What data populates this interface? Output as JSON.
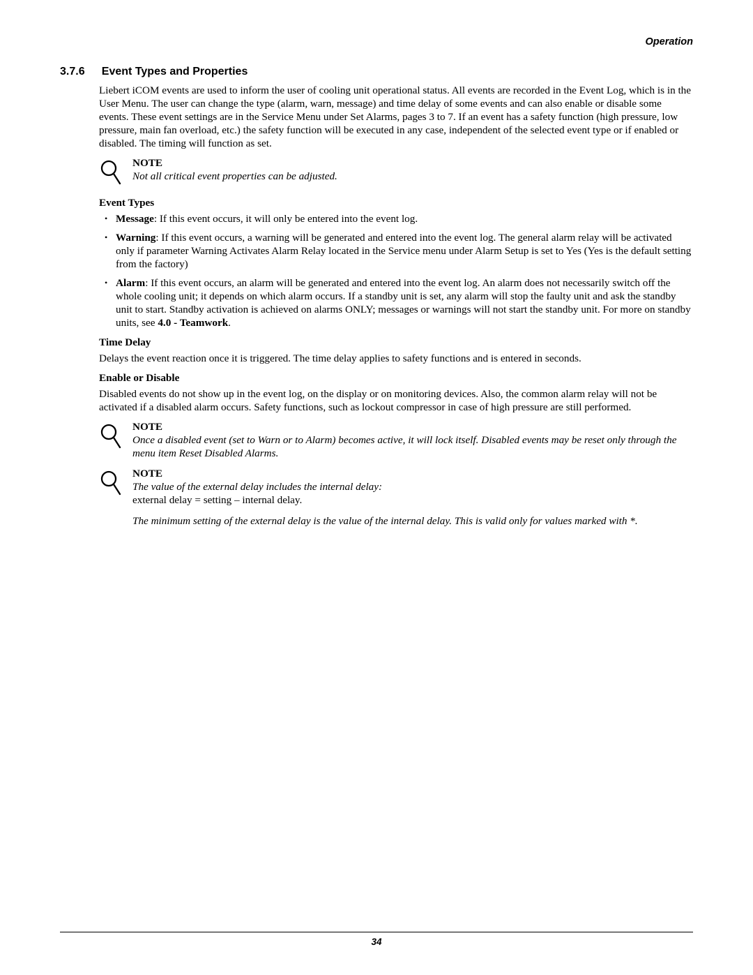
{
  "header": {
    "section_label": "Operation"
  },
  "section": {
    "number": "3.7.6",
    "title": "Event Types and Properties",
    "intro": "Liebert iCOM events are used to inform the user of cooling unit operational status. All events are recorded in the Event Log, which is in the User Menu. The user can change the type (alarm, warn, message) and time delay of some events and can also enable or disable some events. These event settings are in the Service Menu under Set Alarms, pages 3 to 7. If an event has a safety function (high pressure, low pressure, main fan overload, etc.) the safety function will be executed in any case, independent of the selected event type or if enabled or disabled. The timing will function as set."
  },
  "notes": {
    "label": "NOTE",
    "n1": "Not all critical event properties can be adjusted.",
    "n2": "Once a disabled event (set to Warn or to Alarm) becomes active, it will lock itself. Disabled events may be reset only through the menu item Reset Disabled Alarms.",
    "n3_line1": "The value of the external delay includes the internal delay:",
    "n3_line2": "external delay = setting – internal delay.",
    "n3_line3": "The minimum setting of the external delay is the value of the internal delay. This is valid only for values marked with *."
  },
  "event_types": {
    "heading": "Event Types",
    "items": [
      {
        "name": "Message",
        "text": ": If this event occurs, it will only be entered into the event log."
      },
      {
        "name": "Warning",
        "text": ": If this event occurs, a warning will be generated and entered into the event log. The general alarm relay will be activated only if parameter Warning Activates Alarm Relay located in the Service menu under Alarm Setup is set to Yes (Yes is the default setting from the factory)"
      },
      {
        "name": "Alarm",
        "text_pre": ": If this event occurs, an alarm will be generated and entered into the event log. An alarm does not necessarily switch off the whole cooling unit; it depends on which alarm occurs. If a standby unit is set, any alarm will stop the faulty unit and ask the standby unit to start. Standby activation is achieved on alarms ONLY; messages or warnings will not start the standby unit. For more on standby units, see ",
        "xref": "4.0 - Teamwork",
        "text_post": "."
      }
    ]
  },
  "time_delay": {
    "heading": "Time Delay",
    "text": "Delays the event reaction once it is triggered. The time delay applies to safety functions and is entered in seconds."
  },
  "enable_disable": {
    "heading": "Enable or Disable",
    "text": "Disabled events do not show up in the event log, on the display or on monitoring devices. Also, the common alarm relay will not be activated if a disabled alarm occurs. Safety functions, such as lockout compressor in case of high pressure are still performed."
  },
  "footer": {
    "page_number": "34"
  }
}
